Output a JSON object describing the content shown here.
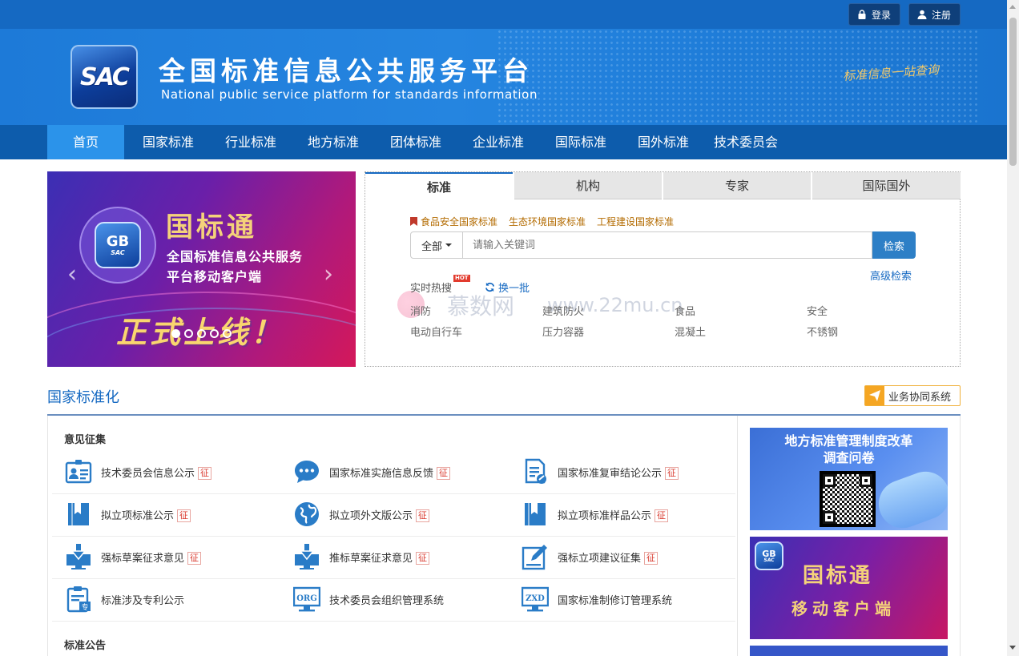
{
  "auth": {
    "login_label": "登录",
    "register_label": "注册"
  },
  "header": {
    "logo_text": "SAC",
    "title": "全国标准信息公共服务平台",
    "subtitle": "National public service platform  for standards information",
    "slogan": "标准信息一站查询"
  },
  "nav": {
    "items": [
      {
        "label": "首页",
        "active": true
      },
      {
        "label": "国家标准"
      },
      {
        "label": "行业标准"
      },
      {
        "label": "地方标准"
      },
      {
        "label": "团体标准"
      },
      {
        "label": "企业标准"
      },
      {
        "label": "国际标准"
      },
      {
        "label": "国外标准"
      },
      {
        "label": "技术委员会"
      }
    ]
  },
  "carousel": {
    "badge_text": "GB",
    "badge_sub": "SAC",
    "title": "国标通",
    "line1": "全国标准信息公共服务",
    "line2": "平台移动客户端",
    "launch": "正式上线！",
    "slide_count": 5,
    "active_slide": 1
  },
  "search": {
    "tabs": [
      "标准",
      "机构",
      "专家",
      "国际国外"
    ],
    "active_tab": 0,
    "quick_links": [
      "食品安全国家标准",
      "生态环境国家标准",
      "工程建设国家标准"
    ],
    "scope_label": "全部",
    "placeholder": "请输入关键词",
    "button_label": "检索",
    "advanced_label": "高级检索",
    "hot_label": "实时热搜",
    "hot_badge": "HOT",
    "refresh_label": "换一批",
    "hot_words": [
      "消防",
      "建筑防火",
      "食品",
      "安全",
      "电动自行车",
      "压力容器",
      "混凝土",
      "不锈钢"
    ]
  },
  "watermark": {
    "text": "慕数网",
    "url": "www.22mu.cn"
  },
  "section": {
    "title": "国家标准化",
    "collab_label": "业务协同系统",
    "comments_title": "意见征集",
    "announcements_title": "标准公告",
    "tag_label": "征",
    "entries": [
      {
        "label": "技术委员会信息公示",
        "tag": true,
        "icon": "id-card-icon"
      },
      {
        "label": "国家标准实施信息反馈",
        "tag": true,
        "icon": "chat-bubble-icon"
      },
      {
        "label": "国家标准复审结论公示",
        "tag": true,
        "icon": "document-edit-icon"
      },
      {
        "label": "拟立项标准公示",
        "tag": true,
        "icon": "bookmark-book-icon"
      },
      {
        "label": "拟立项外文版公示",
        "tag": true,
        "icon": "globe-icon"
      },
      {
        "label": "拟立项标准样品公示",
        "tag": true,
        "icon": "bookmark-book-icon"
      },
      {
        "label": "强标草案征求意见",
        "tag": true,
        "icon": "download-monitor-icon"
      },
      {
        "label": "推标草案征求意见",
        "tag": true,
        "icon": "download-monitor-icon"
      },
      {
        "label": "强标立项建议征集",
        "tag": true,
        "icon": "pen-edit-icon"
      },
      {
        "label": "标准涉及专利公示",
        "tag": false,
        "icon": "patent-clipboard-icon"
      },
      {
        "label": "技术委员会组织管理系统",
        "tag": false,
        "icon": "org-monitor-icon"
      },
      {
        "label": "国家标准制修订管理系统",
        "tag": false,
        "icon": "zxd-monitor-icon"
      }
    ]
  },
  "promos": {
    "survey_title_1": "地方标准管理制度改革",
    "survey_title_2": "调查问卷",
    "app_badge": "GB",
    "app_badge_sub": "SAC",
    "app_title": "国标通",
    "app_subtitle": "移动客户端"
  },
  "colors": {
    "brand": "#1569c2",
    "nav": "#0d5cac",
    "nav_active": "#2b93ea",
    "tag": "#d9352a",
    "accent": "#f5a623"
  }
}
